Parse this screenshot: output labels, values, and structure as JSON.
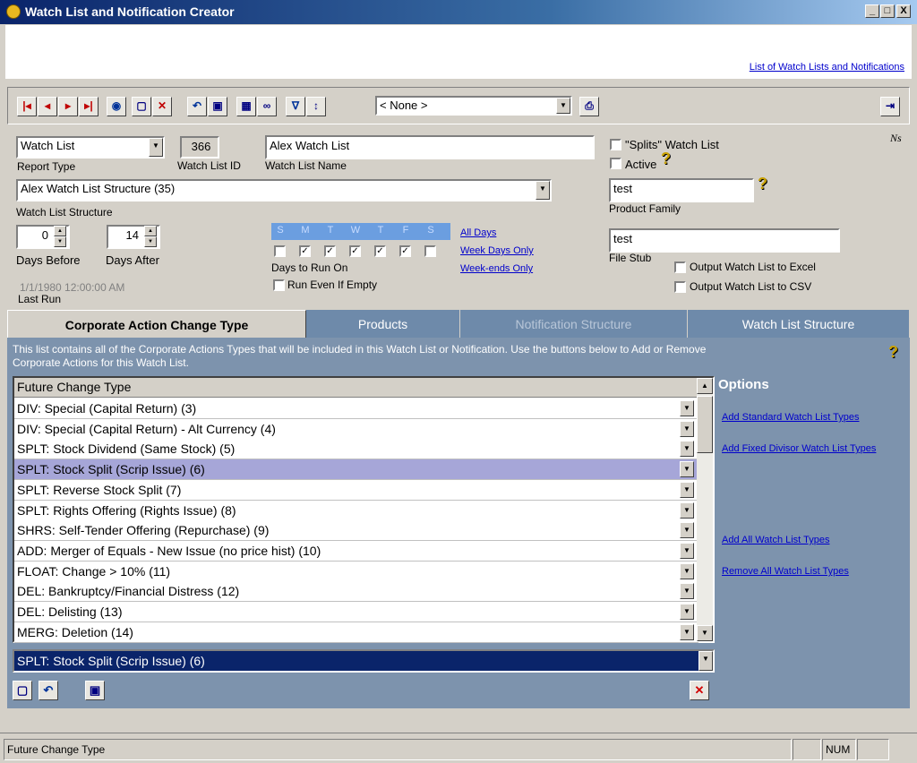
{
  "window": {
    "title": "Watch List and Notification Creator",
    "min": "_",
    "max": "□",
    "close": "X"
  },
  "header": {
    "link": "List of Watch Lists and Notifications"
  },
  "toolbar": {
    "filter_combo": "< None >"
  },
  "form": {
    "report_type": {
      "value": "Watch List",
      "label": "Report Type"
    },
    "watch_list_id": {
      "value": "366",
      "label": "Watch List ID"
    },
    "watch_list_name": {
      "value": "Alex Watch List",
      "label": "Watch List Name"
    },
    "splits_label": "\"Splits\" Watch List",
    "active_label": "Active",
    "ns_label": "Ns",
    "structure": {
      "value": "Alex Watch List Structure (35)",
      "label": "Watch List Structure"
    },
    "product_family": {
      "value": "test",
      "label": "Product Family"
    },
    "days_before": {
      "value": "0",
      "label": "Days Before"
    },
    "days_after": {
      "value": "14",
      "label": "Days After"
    },
    "day_letters": [
      "S",
      "M",
      "T",
      "W",
      "T",
      "F",
      "S"
    ],
    "day_checked": [
      false,
      true,
      true,
      true,
      true,
      true,
      false
    ],
    "days_label": "Days to Run On",
    "run_if_empty": "Run Even If Empty",
    "all_days": "All Days",
    "week_days": "Week Days Only",
    "week_ends": "Week-ends Only",
    "file_stub": {
      "value": "test",
      "label": "File Stub"
    },
    "output_excel": "Output Watch List to Excel",
    "output_csv": "Output Watch List to CSV",
    "last_run_value": "1/1/1980 12:00:00 AM",
    "last_run_label": "Last Run"
  },
  "tabs": [
    {
      "label": "Corporate Action Change Type"
    },
    {
      "label": "Products"
    },
    {
      "label": "Notification Structure"
    },
    {
      "label": "Watch List Structure"
    }
  ],
  "panel": {
    "description": "This list contains all of the Corporate Actions Types that will be included in this Watch List or Notification. Use the buttons below to Add or Remove Corporate Actions for this Watch List.",
    "column_header": "Future Change Type",
    "rows": [
      "DIV: Special (Capital Return) (3)",
      "DIV: Special (Capital Return) - Alt Currency (4)",
      "SPLT: Stock Dividend (Same Stock) (5)",
      "SPLT: Stock Split (Scrip Issue) (6)",
      "SPLT: Reverse Stock Split (7)",
      "SPLT: Rights Offering  (Rights Issue) (8)",
      "SHRS: Self-Tender Offering  (Repurchase) (9)",
      "ADD: Merger of Equals - New Issue (no price hist) (10)",
      "FLOAT: Change > 10% (11)",
      "DEL: Bankruptcy/Financial Distress (12)",
      "DEL: Delisting (13)",
      "MERG: Deletion (14)"
    ],
    "selected_index": 3,
    "selected_value": "SPLT: Stock Split (Scrip Issue) (6)",
    "options_title": "Options",
    "options": {
      "add_standard": "Add Standard Watch List Types",
      "add_fixed": "Add Fixed Divisor Watch List Types",
      "add_all": "Add All Watch List Types",
      "remove_all": "Remove All Watch List Types"
    }
  },
  "status": {
    "text": "Future Change Type",
    "num": "NUM"
  }
}
